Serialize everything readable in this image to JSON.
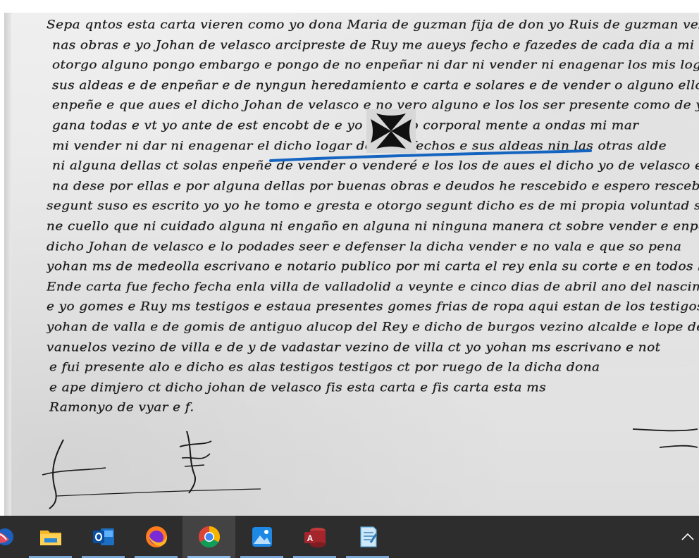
{
  "document": {
    "lines": [
      "Sepa qntos esta carta vieren como yo dona Maria de guzman fija de don yo Ruis de guzman vezino de",
      "nas obras e yo Johan de velasco arcipreste de Ruy me aueys fecho e fazedes de cada dia a mi",
      "otorgo alguno pongo embargo e pongo de no enpeñar ni dar ni vender ni enagenar los mis logares",
      "sus aldeas e de enpeñar e de nyngun heredamiento e carta e solares e de vender o alguno ellos e enpe",
      "enpeñe e que aues el dicho Johan de velasco e no vero alguno e los los ser presente como de yo",
      "gana todas e vt yo ante de est encobt de e yo e tengo corporal mente a ondas mi mar",
      "mi vender ni dar ni enagenar el dicho logar de villa fechos e sus aldeas nin las otras alde",
      "ni alguna dellas ct solas enpeñe de vender o venderé e los los de aues el dicho yo de velasco e",
      "na dese por ellas e por alguna dellas por buenas obras e deudos he rescebido e espero rescebir de d",
      "segunt suso es escrito yo yo he tomo e gresta e otorgo segunt dicho es de mi propia voluntad syn premia alg",
      "ne cuello que ni cuidado alguna ni engaño en alguna ni ninguna manera ct sobre vender e enpeñar e",
      "dicho Johan de velasco e lo podades seer e defenser la dicha vender e no vala e que so pena",
      "yohan ms de medeolla escrivano e notario publico por mi carta el rey enla su corte e en todos los sus",
      "Ende carta fue fecho fecha enla villa de valladolid a veynte e cinco dias de abril ano del nascimiento de",
      "e yo gomes e Ruy ms testigos e estaua presentes gomes frias de ropa aqui estan de los testigos tela carta",
      "yohan de valla e de gomis de antiguo alucop del Rey e dicho de burgos vezino alcalde e lope de frias",
      "vanuelos vezino de villa e de y de vadastar vezino de villa ct yo yohan ms escrivano e not",
      "e fui presente alo e dicho es alas testigos testigos ct por ruego de la dicha dona",
      "e ape dimjero ct dicho johan de velasco fis esta carta e fis carta esta ms",
      "Ramonyo de vyar e f."
    ],
    "cross_mark": "cross-pattee-signum",
    "annotation_underline_color": "#1565c0"
  },
  "taskbar": {
    "apps": [
      {
        "name": "Mozilla Thunderbird",
        "icon": "thunderbird-icon",
        "active": false,
        "running": false
      },
      {
        "name": "File Explorer",
        "icon": "folder-icon",
        "active": false,
        "running": true
      },
      {
        "name": "Outlook",
        "icon": "outlook-icon",
        "active": false,
        "running": true
      },
      {
        "name": "Firefox",
        "icon": "firefox-icon",
        "active": false,
        "running": true
      },
      {
        "name": "Google Chrome",
        "icon": "chrome-icon",
        "active": true,
        "running": true
      },
      {
        "name": "Photos",
        "icon": "photos-icon",
        "active": false,
        "running": true
      },
      {
        "name": "Access",
        "icon": "access-icon",
        "active": false,
        "running": true
      },
      {
        "name": "Notes",
        "icon": "notepad-icon",
        "active": false,
        "running": true
      }
    ],
    "tray": {
      "show_hidden_icon": "chevron-up-icon"
    }
  }
}
